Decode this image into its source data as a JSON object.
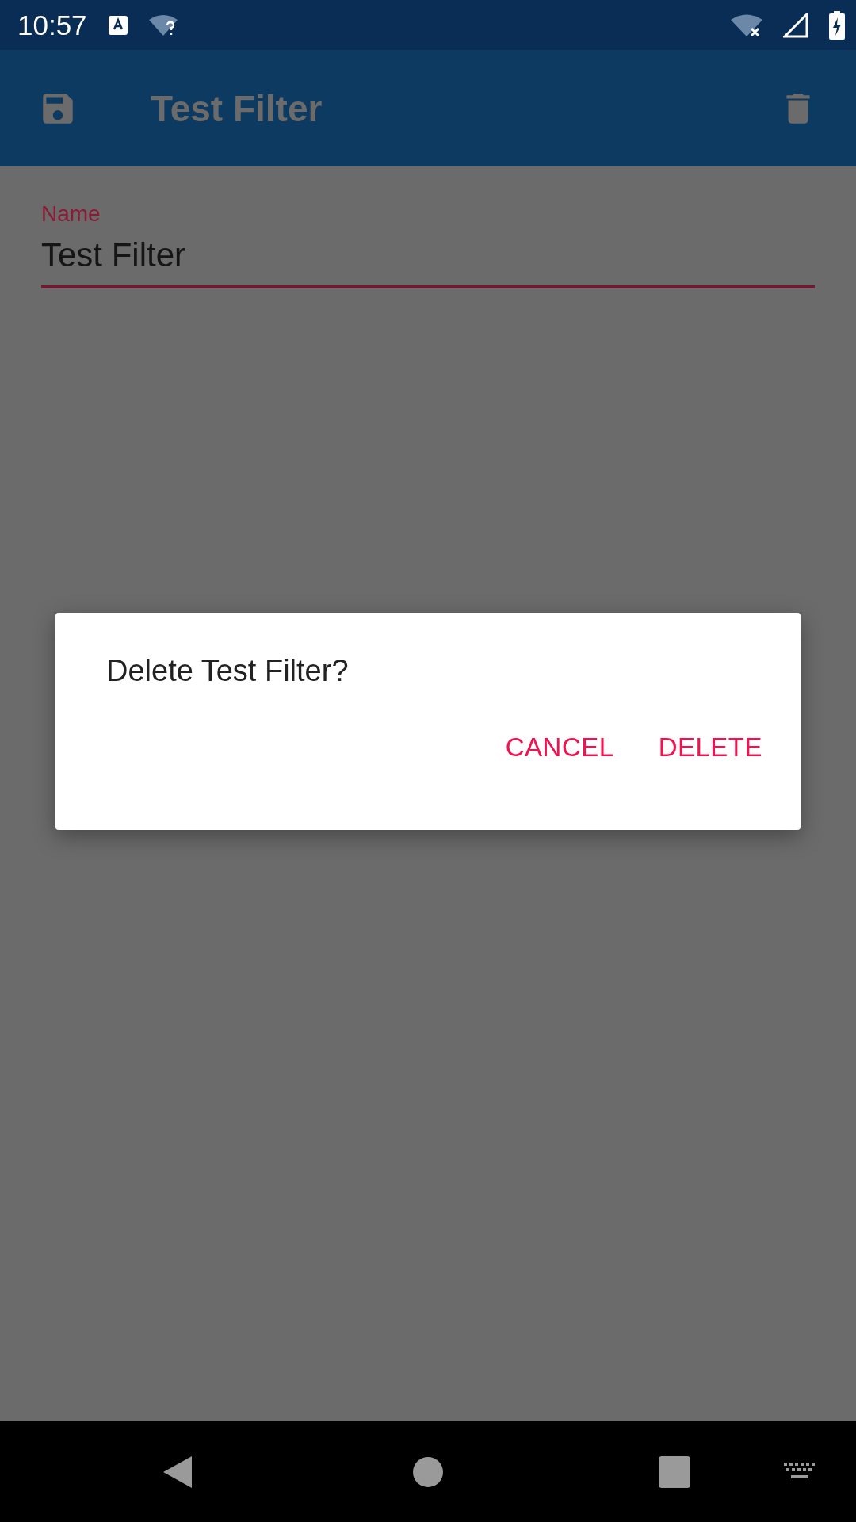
{
  "status_bar": {
    "time": "10:57"
  },
  "app_bar": {
    "title": "Test Filter"
  },
  "form": {
    "name_field": {
      "label": "Name",
      "value": "Test Filter"
    }
  },
  "dialog": {
    "message": "Delete Test Filter?",
    "buttons": [
      "CANCEL",
      "DELETE"
    ]
  }
}
